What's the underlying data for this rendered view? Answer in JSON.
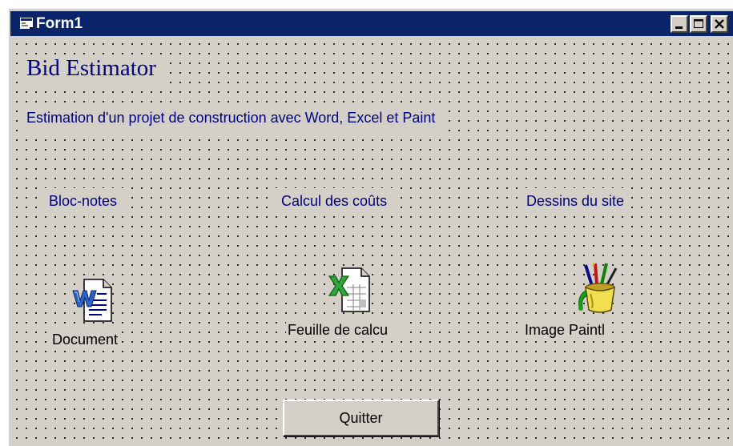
{
  "window": {
    "title": "Form1",
    "icon": "form-window-icon",
    "colors": {
      "titlebar": "#0a246a",
      "face": "#d4d0c8",
      "label_text": "#000080"
    }
  },
  "form": {
    "app_title": "Bid Estimator",
    "subtitle": "Estimation d'un projet de construction avec Word, Excel et Paint",
    "sections": [
      {
        "label": "Bloc-notes",
        "icon": "word-document-icon",
        "caption": "Document"
      },
      {
        "label": "Calcul des coûts",
        "icon": "excel-spreadsheet-icon",
        "caption": "Feuille de calcu"
      },
      {
        "label": "Dessins du site",
        "icon": "paint-bucket-icon",
        "caption": "Image Paintl"
      }
    ],
    "quit_label": "Quitter"
  }
}
